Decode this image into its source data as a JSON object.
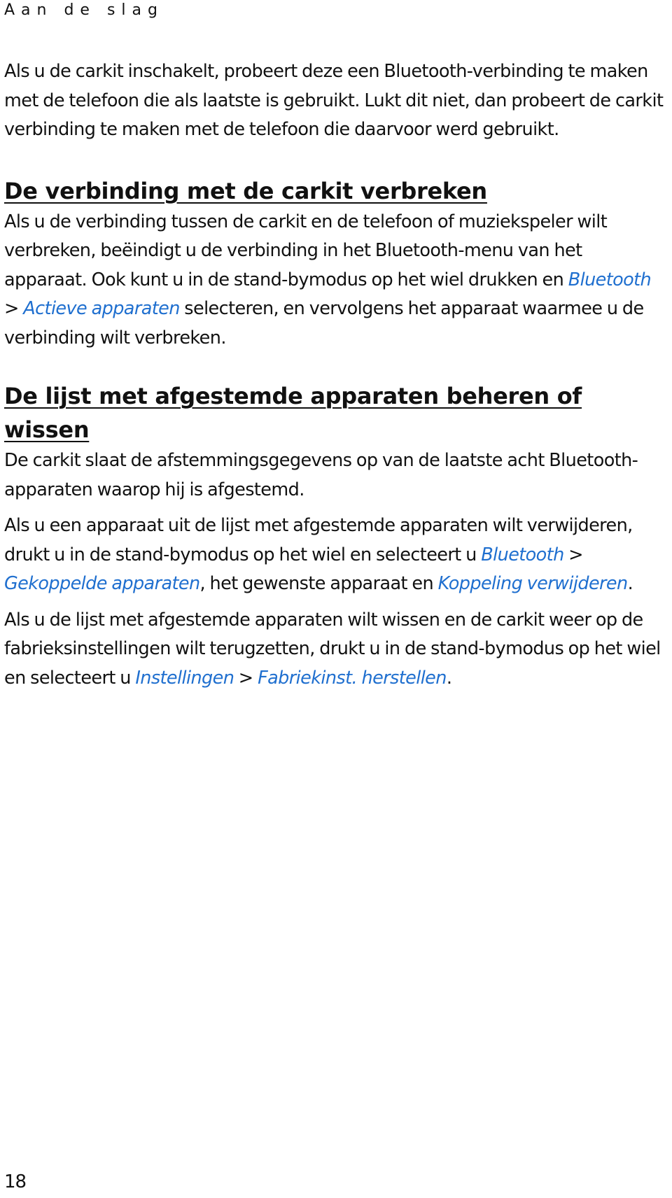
{
  "header": {
    "running_head": "Aan de slag"
  },
  "intro": {
    "text": "Als u de carkit inschakelt, probeert deze een Bluetooth-verbinding te maken met de telefoon die als laatste is gebruikt. Lukt dit niet, dan probeert de carkit verbinding te maken met de telefoon die daarvoor werd gebruikt."
  },
  "section1": {
    "heading": "De verbinding met de carkit verbreken",
    "p1_a": "Als u de verbinding tussen de carkit en de telefoon of muziekspeler wilt verbreken, beëindigt u de verbinding in het Bluetooth-menu van het apparaat. Ook kunt u in de stand-bymodus op het wiel drukken en ",
    "menu1": "Bluetooth",
    "sep1": " > ",
    "menu2": "Actieve apparaten",
    "p1_b": " selecteren, en vervolgens het apparaat waarmee u de verbinding wilt verbreken."
  },
  "section2": {
    "heading": "De lijst met afgestemde apparaten beheren of wissen",
    "p1": "De carkit slaat de afstemmingsgegevens op van de laatste acht Bluetooth-apparaten waarop hij is afgestemd.",
    "p2_a": "Als u een apparaat uit de lijst met afgestemde apparaten wilt verwijderen, drukt u in de stand-bymodus op het wiel en selecteert u ",
    "p2_menu1": "Bluetooth",
    "p2_sep1": " > ",
    "p2_menu2": "Gekoppelde apparaten",
    "p2_b": ", het gewenste apparaat en ",
    "p2_menu3": "Koppeling verwijderen",
    "p2_c": ".",
    "p3_a": "Als u de lijst met afgestemde apparaten wilt wissen en de carkit weer op de fabrieksinstellingen wilt terugzetten, drukt u in de stand-bymodus op het wiel en selecteert u ",
    "p3_menu1": "Instellingen",
    "p3_sep1": " > ",
    "p3_menu2": "Fabriekinst. herstellen",
    "p3_b": "."
  },
  "footer": {
    "page_number": "18"
  },
  "colors": {
    "menu_link": "#1f6fcf",
    "text": "#111111"
  }
}
